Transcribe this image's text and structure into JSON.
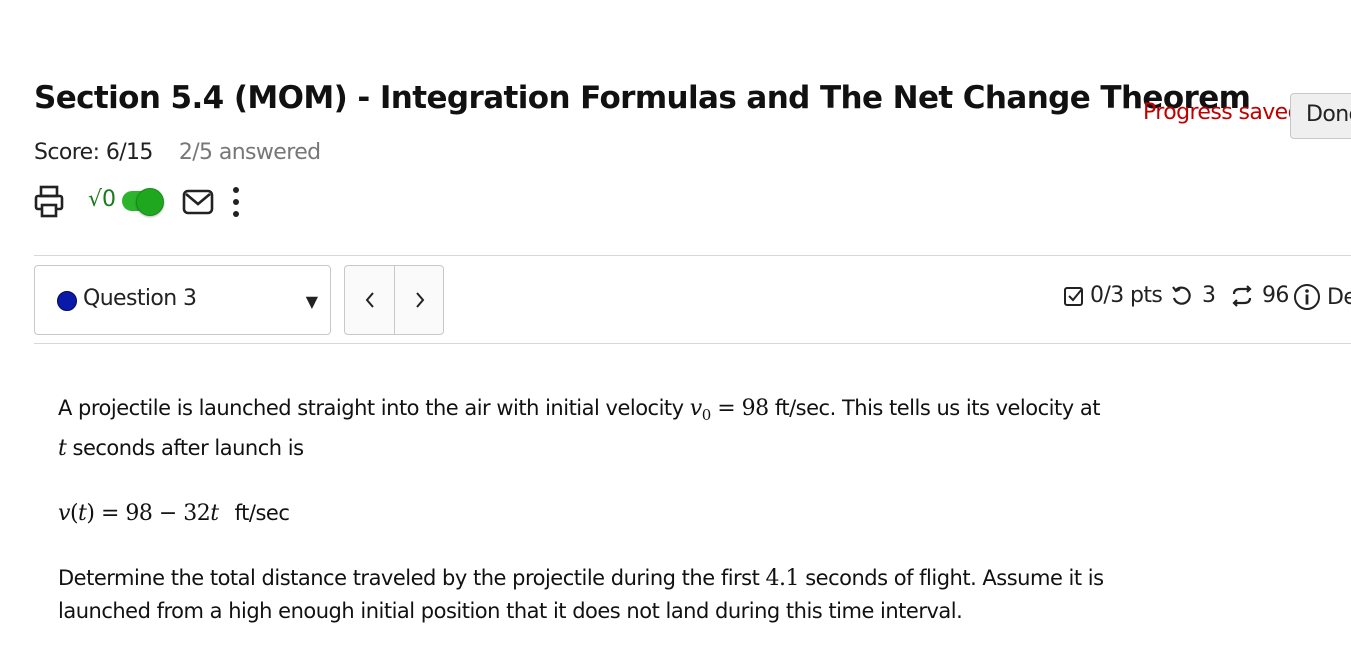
{
  "header": {
    "title": "Section 5.4 (MOM) - Integration Formulas and The Net Change Theorem",
    "progress_saved": "Progress saved",
    "done_label": "Done",
    "score": "Score: 6/15",
    "answered": "2/5 answered"
  },
  "toolbar": {
    "math_label": "√0",
    "icons": [
      "print-icon",
      "math-toggle",
      "mail-icon",
      "more-vertical-icon"
    ],
    "toggle_color": "#2cb52c"
  },
  "question_nav": {
    "selected": "Question 3",
    "status_dot_color": "#0a1aa8",
    "prev_label": "‹",
    "next_label": "›"
  },
  "meta": {
    "points": "0/3 pts",
    "retries": "3",
    "versions": "96",
    "details": "De"
  },
  "question": {
    "p1_a": "A projectile is launched straight into the air with initial velocity ",
    "v0_var": "v",
    "v0_sub": "0",
    "v0_eq": " = 98",
    "p1_b": " ft/sec. This tells us its velocity at",
    "t_var": "t",
    "p1_c": " seconds after launch is",
    "formula_v": "v",
    "formula_open": "(",
    "formula_t": "t",
    "formula_close": ")",
    "formula_rhs": " = 98 − 32",
    "formula_t2": "t",
    "formula_unit": "ft/sec",
    "p2_a": "Determine the total distance traveled by the projectile during the first ",
    "p2_num": "4.1",
    "p2_b": " seconds of flight. Assume it is",
    "p2_c": "launched from a high enough initial position that it does not land during this time interval."
  }
}
